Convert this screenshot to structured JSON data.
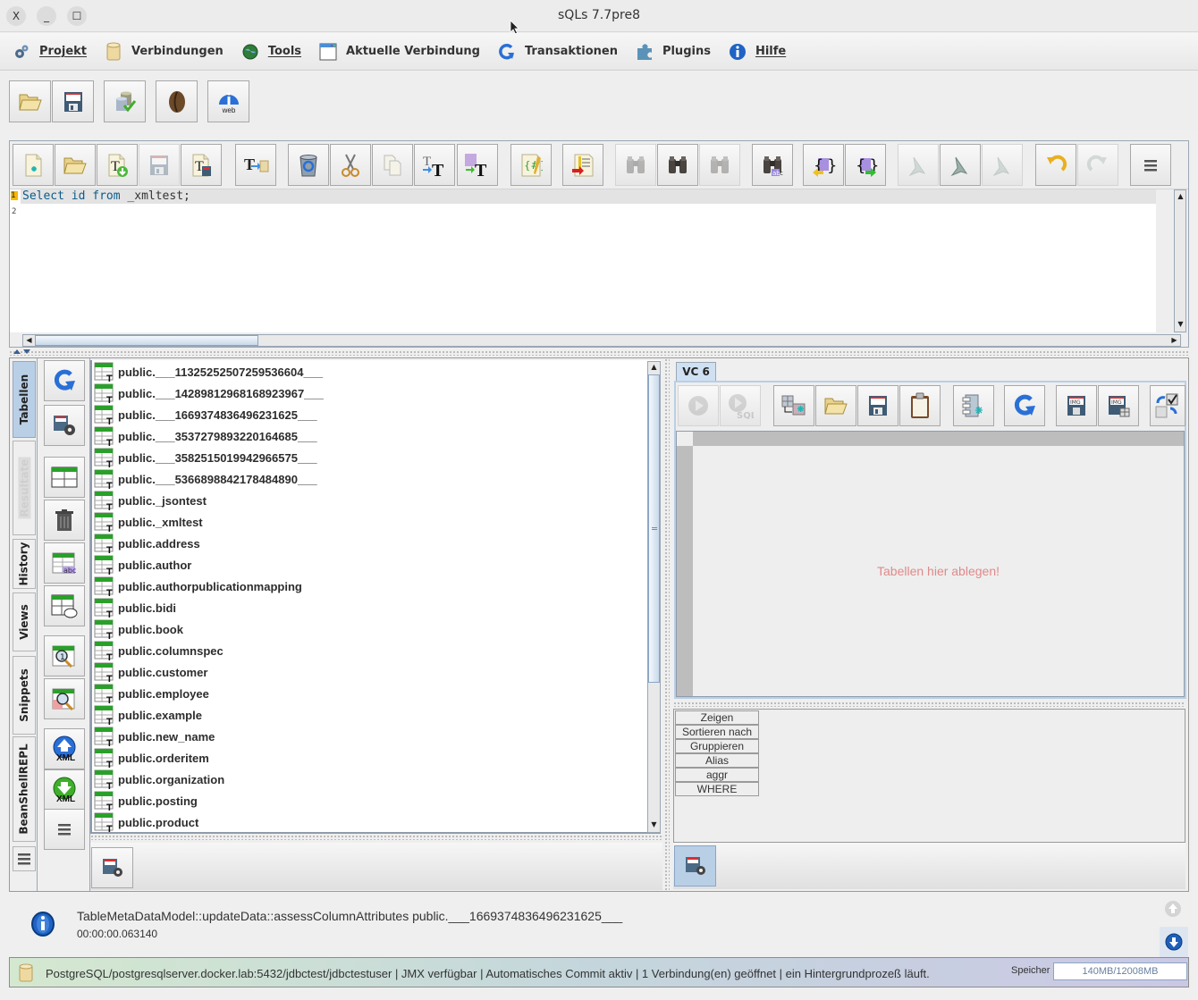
{
  "window": {
    "title": "sQLs 7.7pre8",
    "close_label": "X",
    "minimize_label": "_",
    "maximize_label": "☐"
  },
  "menubar": {
    "items": [
      {
        "label": "Projekt",
        "icon": "gears-icon"
      },
      {
        "label": "Verbindungen",
        "icon": "database-cylinder-icon"
      },
      {
        "label": "Tools",
        "icon": "globe-icon"
      },
      {
        "label": "Aktuelle Verbindung",
        "icon": "window-icon"
      },
      {
        "label": "Transaktionen",
        "icon": "refresh-icon"
      },
      {
        "label": "Plugins",
        "icon": "puzzle-icon"
      },
      {
        "label": "Hilfe",
        "icon": "info-icon"
      }
    ]
  },
  "main_toolbar": {
    "buttons": [
      {
        "name": "open-project",
        "icon": "folder-icon"
      },
      {
        "name": "save-project",
        "icon": "floppy-icon"
      },
      {
        "name": "connection-check",
        "icon": "database-check-icon"
      },
      {
        "name": "java-bean",
        "icon": "coffee-bean-icon"
      },
      {
        "name": "web-info",
        "icon": "web-info-icon",
        "label": "web"
      }
    ]
  },
  "editor_toolbar": {
    "buttons": [
      {
        "name": "new-file",
        "icon": "new-file-icon",
        "enabled": true
      },
      {
        "name": "open-file",
        "icon": "folder-icon",
        "enabled": true
      },
      {
        "name": "load-template",
        "icon": "template-download-icon",
        "enabled": true
      },
      {
        "name": "save",
        "icon": "floppy-icon",
        "enabled": false
      },
      {
        "name": "save-as",
        "icon": "template-save-icon",
        "enabled": true
      },
      {
        "name": "text-to-db",
        "icon": "text-db-icon",
        "enabled": true
      },
      {
        "name": "recycle",
        "icon": "recycle-bin-icon",
        "enabled": true
      },
      {
        "name": "cut",
        "icon": "scissors-icon",
        "enabled": true
      },
      {
        "name": "copy",
        "icon": "copy-icon",
        "enabled": true
      },
      {
        "name": "uppercase",
        "icon": "uppercase-icon",
        "enabled": true
      },
      {
        "name": "lowercase",
        "icon": "lowercase-icon",
        "enabled": true
      },
      {
        "name": "format",
        "icon": "format-pencil-icon",
        "enabled": true
      },
      {
        "name": "export-text",
        "icon": "export-text-icon",
        "enabled": true
      },
      {
        "name": "find-previous",
        "icon": "binoculars-left-icon",
        "enabled": false
      },
      {
        "name": "find",
        "icon": "binoculars-icon",
        "enabled": true
      },
      {
        "name": "find-next",
        "icon": "binoculars-right-icon",
        "enabled": false
      },
      {
        "name": "find-replace",
        "icon": "binoculars-abc-icon",
        "enabled": true
      },
      {
        "name": "brace-prev",
        "icon": "brace-left-arrow-icon",
        "enabled": true
      },
      {
        "name": "brace-next",
        "icon": "brace-right-arrow-icon",
        "enabled": true
      },
      {
        "name": "bookmark-prev",
        "icon": "bookmark-prev-icon",
        "enabled": false
      },
      {
        "name": "bookmark",
        "icon": "bookmark-icon",
        "enabled": true
      },
      {
        "name": "bookmark-next",
        "icon": "bookmark-next-icon",
        "enabled": false
      },
      {
        "name": "undo",
        "icon": "undo-icon",
        "enabled": true
      },
      {
        "name": "redo",
        "icon": "redo-icon",
        "enabled": false
      },
      {
        "name": "more",
        "icon": "hamburger-icon",
        "enabled": true
      }
    ]
  },
  "editor": {
    "lines": [
      "Select id from _xmltest;",
      ""
    ],
    "line_numbers": [
      "1",
      "2"
    ],
    "tokens": [
      {
        "text": "Select",
        "kw": true
      },
      {
        "text": " ",
        "kw": false
      },
      {
        "text": "id",
        "kw": true
      },
      {
        "text": " ",
        "kw": false
      },
      {
        "text": "from",
        "kw": true
      },
      {
        "text": " _xmltest;",
        "kw": false
      }
    ]
  },
  "vertical_tabs": [
    {
      "label": "Tabellen",
      "active": true,
      "enabled": true
    },
    {
      "label": "Resultate",
      "active": false,
      "enabled": false
    },
    {
      "label": "History",
      "active": false,
      "enabled": true
    },
    {
      "label": "Views",
      "active": false,
      "enabled": true
    },
    {
      "label": "Snippets",
      "active": false,
      "enabled": true
    },
    {
      "label": "BeanShellREPL",
      "active": false,
      "enabled": true
    }
  ],
  "side_buttons": [
    {
      "name": "refresh",
      "icon": "refresh-icon"
    },
    {
      "name": "save-settings",
      "icon": "floppy-gear-icon"
    },
    {
      "name": "show-table",
      "icon": "table-icon"
    },
    {
      "name": "delete",
      "icon": "trash-icon"
    },
    {
      "name": "table-rename",
      "icon": "table-abc-icon"
    },
    {
      "name": "table-comment",
      "icon": "table-comment-icon"
    },
    {
      "name": "table-count",
      "icon": "table-magnify-icon"
    },
    {
      "name": "table-inspect",
      "icon": "table-inspect-icon"
    },
    {
      "name": "xml-export",
      "icon": "xml-upload-icon"
    },
    {
      "name": "xml-import",
      "icon": "xml-download-icon"
    },
    {
      "name": "more",
      "icon": "hamburger-icon"
    }
  ],
  "table_list": {
    "items": [
      "public.___11325252507259536604___",
      "public.___14289812968168923967___",
      "public.___1669374836496231625___",
      "public.___3537279893220164685___",
      "public.___3582515019942966575___",
      "public.___5366898842178484890___",
      "public._jsontest",
      "public._xmltest",
      "public.address",
      "public.author",
      "public.authorpublicationmapping",
      "public.bidi",
      "public.book",
      "public.columnspec",
      "public.customer",
      "public.employee",
      "public.example",
      "public.new_name",
      "public.orderitem",
      "public.organization",
      "public.posting",
      "public.product"
    ]
  },
  "vc_panel": {
    "tab_label": "VC 6",
    "drop_hint": "Tabellen hier ablegen!",
    "buttons": [
      {
        "name": "run",
        "icon": "play-icon",
        "enabled": false
      },
      {
        "name": "run-sql",
        "icon": "play-sql-icon",
        "enabled": false,
        "label": "SQL"
      },
      {
        "name": "add-join",
        "icon": "table-join-icon",
        "enabled": true
      },
      {
        "name": "open",
        "icon": "folder-icon",
        "enabled": true
      },
      {
        "name": "save",
        "icon": "floppy-icon",
        "enabled": true
      },
      {
        "name": "clipboard",
        "icon": "clipboard-icon",
        "enabled": true
      },
      {
        "name": "new-column",
        "icon": "column-new-icon",
        "enabled": true
      },
      {
        "name": "refresh",
        "icon": "refresh-icon",
        "enabled": true
      },
      {
        "name": "save-image",
        "icon": "floppy-img-icon",
        "enabled": true,
        "label": "IMG"
      },
      {
        "name": "save-image-table",
        "icon": "floppy-img-table-icon",
        "enabled": true,
        "label": "IMG"
      },
      {
        "name": "toggle-check",
        "icon": "toggle-check-icon",
        "enabled": true
      }
    ]
  },
  "query_grid": {
    "row_labels": [
      "Zeigen",
      "Sortieren nach",
      "Gruppieren",
      "Alias",
      "aggr",
      "WHERE"
    ]
  },
  "messages": {
    "text": "TableMetaDataModel::updateData::assessColumnAttributes public.___1669374836496231625___",
    "time": "00:00:00.063140"
  },
  "statusbar": {
    "text": "PostgreSQL/postgresqlserver.docker.lab:5432/jdbctest/jdbctestuser | JMX verfügbar | Automatisches Commit aktiv | 1 Verbindung(en) geöffnet | ein Hintergrundprozeß läuft.",
    "memory_label": "Speicher",
    "memory_value": "140MB/12008MB"
  }
}
